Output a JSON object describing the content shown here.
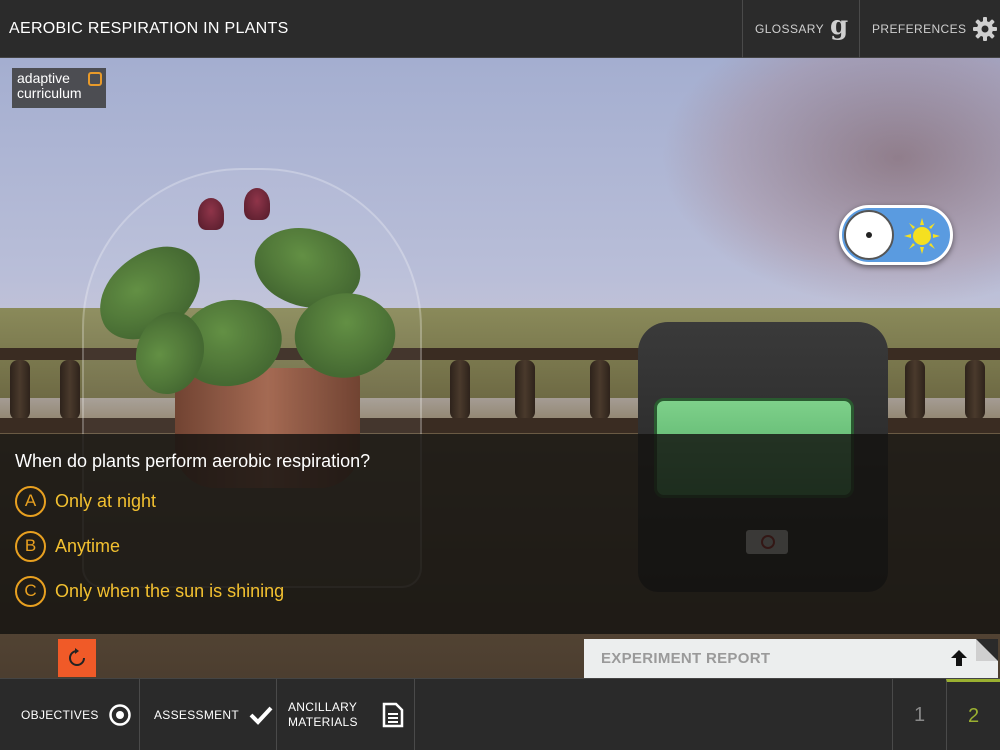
{
  "header": {
    "title": "AEROBIC RESPIRATION IN PLANTS",
    "glossary_label": "GLOSSARY",
    "preferences_label": "PREFERENCES"
  },
  "logo": {
    "line1": "adaptive",
    "line2": "curriculum"
  },
  "toggle": {
    "state": "day",
    "icons": [
      "moon-dot-icon",
      "sun-icon"
    ],
    "colors": {
      "track": "#5a9be0",
      "sun": "#f5e020"
    }
  },
  "question": {
    "prompt": "When do plants perform aerobic respiration?",
    "options": [
      {
        "letter": "A",
        "text": "Only at night"
      },
      {
        "letter": "B",
        "text": "Anytime"
      },
      {
        "letter": "C",
        "text": "Only when the sun is shining"
      }
    ]
  },
  "report": {
    "label": "EXPERIMENT REPORT"
  },
  "footer": {
    "objectives_label": "OBJECTIVES",
    "assessment_label": "ASSESSMENT",
    "ancillary_label": "ANCILLARY\nMATERIALS",
    "pages": [
      "1",
      "2"
    ],
    "current_page": "2"
  },
  "colors": {
    "accent": "#f05a28",
    "option_text": "#f2c030",
    "option_ring": "#e8a020",
    "active_page": "#9ab030"
  }
}
